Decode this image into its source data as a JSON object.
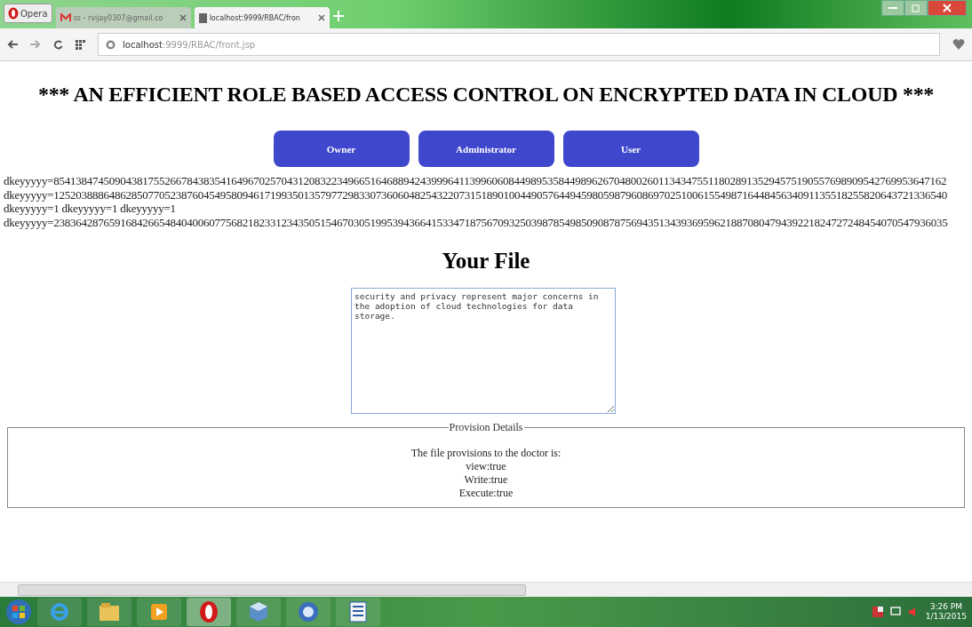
{
  "browser": {
    "menu_label": "Opera",
    "tabs": [
      {
        "kind": "mail",
        "title": "ss - rvijay0307@gmail.co",
        "selected": false
      },
      {
        "kind": "page",
        "title": "localhost:9999/RBAC/fron",
        "selected": true
      }
    ],
    "address": {
      "host": "localhost",
      "path": ":9999/RBAC/front.jsp"
    }
  },
  "page": {
    "title": "*** AN EFFICIENT ROLE BASED ACCESS CONTROL ON ENCRYPTED DATA IN CLOUD ***",
    "buttons": [
      "Owner",
      "Administrator",
      "User"
    ],
    "key_lines": [
      "dkeyyyyy=85413847450904381755266784383541649670257043120832234966516468894243999641139960608449895358449896267048002601134347551180289135294575190557698909542769953647162",
      "dkeyyyyy=12520388864862850770523876045495809461719935013579772983307360604825432207315189010044905764494598059879608697025100615549871644845634091135518255820643721336540",
      "dkeyyyyy=1 dkeyyyyy=1 dkeyyyyy=1",
      "dkeyyyyy=23836428765916842665484040060775682182331234350515467030519953943664153347187567093250398785498509087875694351343936959621887080479439221824727248454070547936035"
    ],
    "file_heading": "Your File",
    "file_text": "security and privacy represent major concerns in the adoption of cloud technologies for data storage.",
    "provision": {
      "legend": "Provision Details",
      "lines": [
        "The file provisions to the doctor is:",
        "view:true",
        "Write:true",
        "Execute:true"
      ]
    }
  },
  "taskbar": {
    "apps": [
      {
        "kind": "ie"
      },
      {
        "kind": "folder"
      },
      {
        "kind": "media"
      },
      {
        "kind": "opera",
        "selected": true
      },
      {
        "kind": "box"
      },
      {
        "kind": "disc"
      },
      {
        "kind": "word"
      }
    ],
    "time": "3:26 PM",
    "date": "1/13/2015"
  }
}
